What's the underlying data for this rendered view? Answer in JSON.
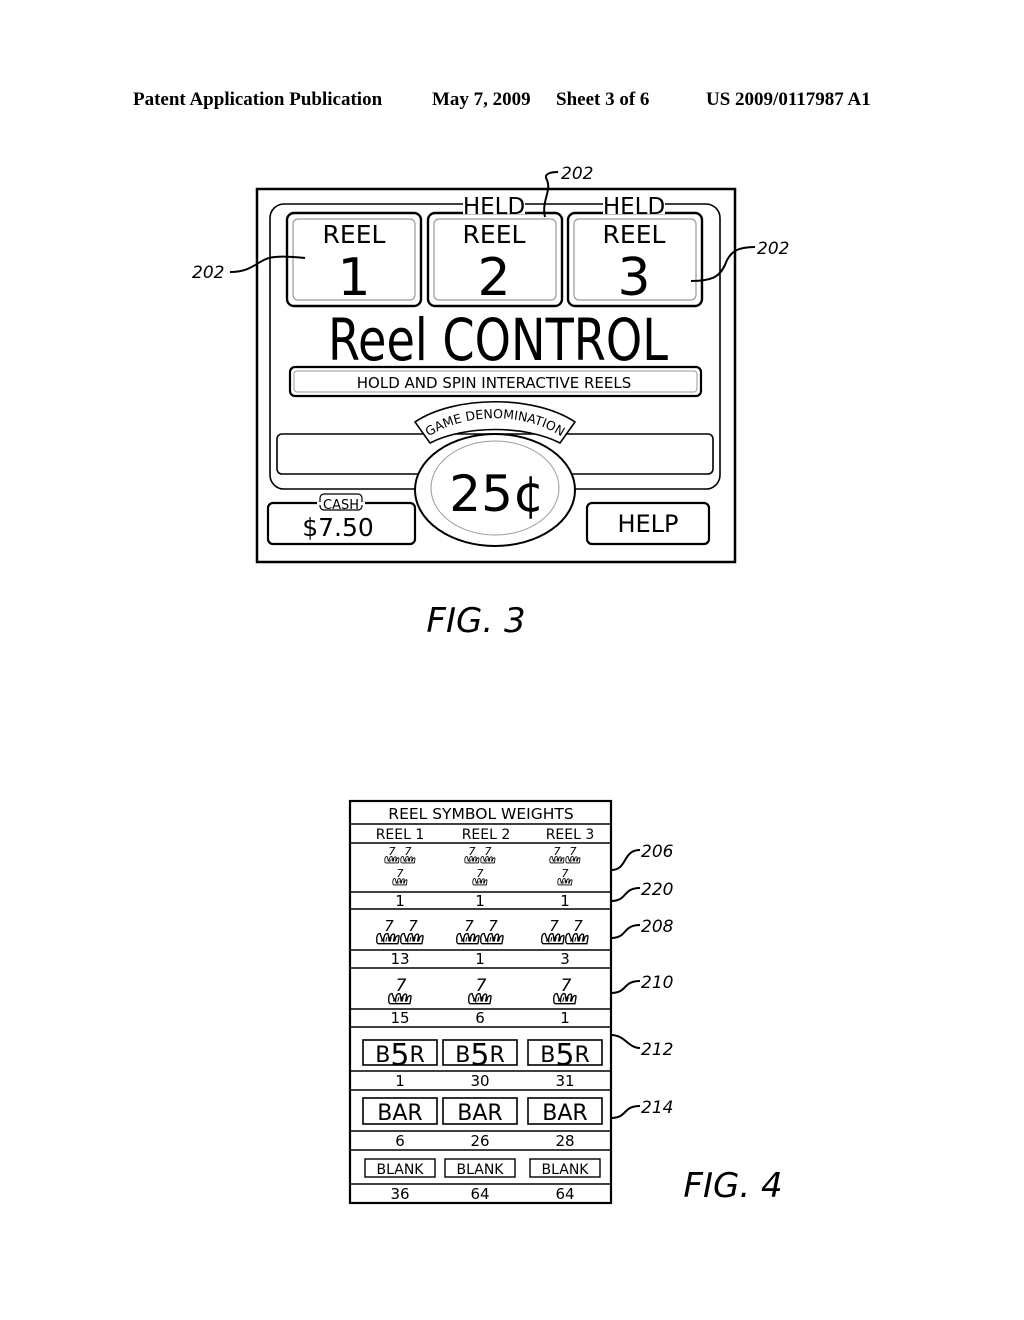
{
  "header": {
    "publication": "Patent Application Publication",
    "date": "May 7, 2009",
    "sheet": "Sheet 3 of 6",
    "number": "US 2009/0117987 A1"
  },
  "fig3": {
    "caption": "FIG. 3",
    "reels": [
      {
        "label": "REEL",
        "number": "1",
        "held": false,
        "held_label": ""
      },
      {
        "label": "REEL",
        "number": "2",
        "held": true,
        "held_label": "HELD"
      },
      {
        "label": "REEL",
        "number": "3",
        "held": true,
        "held_label": "HELD"
      }
    ],
    "title": "Reel CONTROL",
    "instruction": "HOLD AND SPIN INTERACTIVE REELS",
    "message_bar": "",
    "denomination": {
      "label": "GAME DENOMINATION",
      "value": "25¢"
    },
    "cash": {
      "label": "CASH",
      "value": "$7.50"
    },
    "help_label": "HELP",
    "refs": {
      "left": "202",
      "top": "202",
      "right": "202"
    }
  },
  "fig4": {
    "caption": "FIG. 4",
    "chart_data": {
      "type": "table",
      "title": "REEL SYMBOL WEIGHTS",
      "columns": [
        "REEL 1",
        "REEL 2",
        "REEL 3"
      ],
      "rows": [
        {
          "symbol": "triple-seven-icon",
          "ref": "206",
          "weight_ref": "220",
          "weights": [
            1,
            1,
            1
          ]
        },
        {
          "symbol": "double-seven-icon",
          "ref": "208",
          "weights": [
            13,
            1,
            3
          ]
        },
        {
          "symbol": "single-seven-icon",
          "ref": "210",
          "weights": [
            15,
            6,
            1
          ]
        },
        {
          "symbol": "B5R",
          "ref": "212",
          "weights": [
            1,
            30,
            31
          ]
        },
        {
          "symbol": "BAR",
          "ref": "214",
          "weights": [
            6,
            26,
            28
          ]
        },
        {
          "symbol": "BLANK",
          "ref": "",
          "weights": [
            36,
            64,
            64
          ]
        }
      ]
    }
  }
}
